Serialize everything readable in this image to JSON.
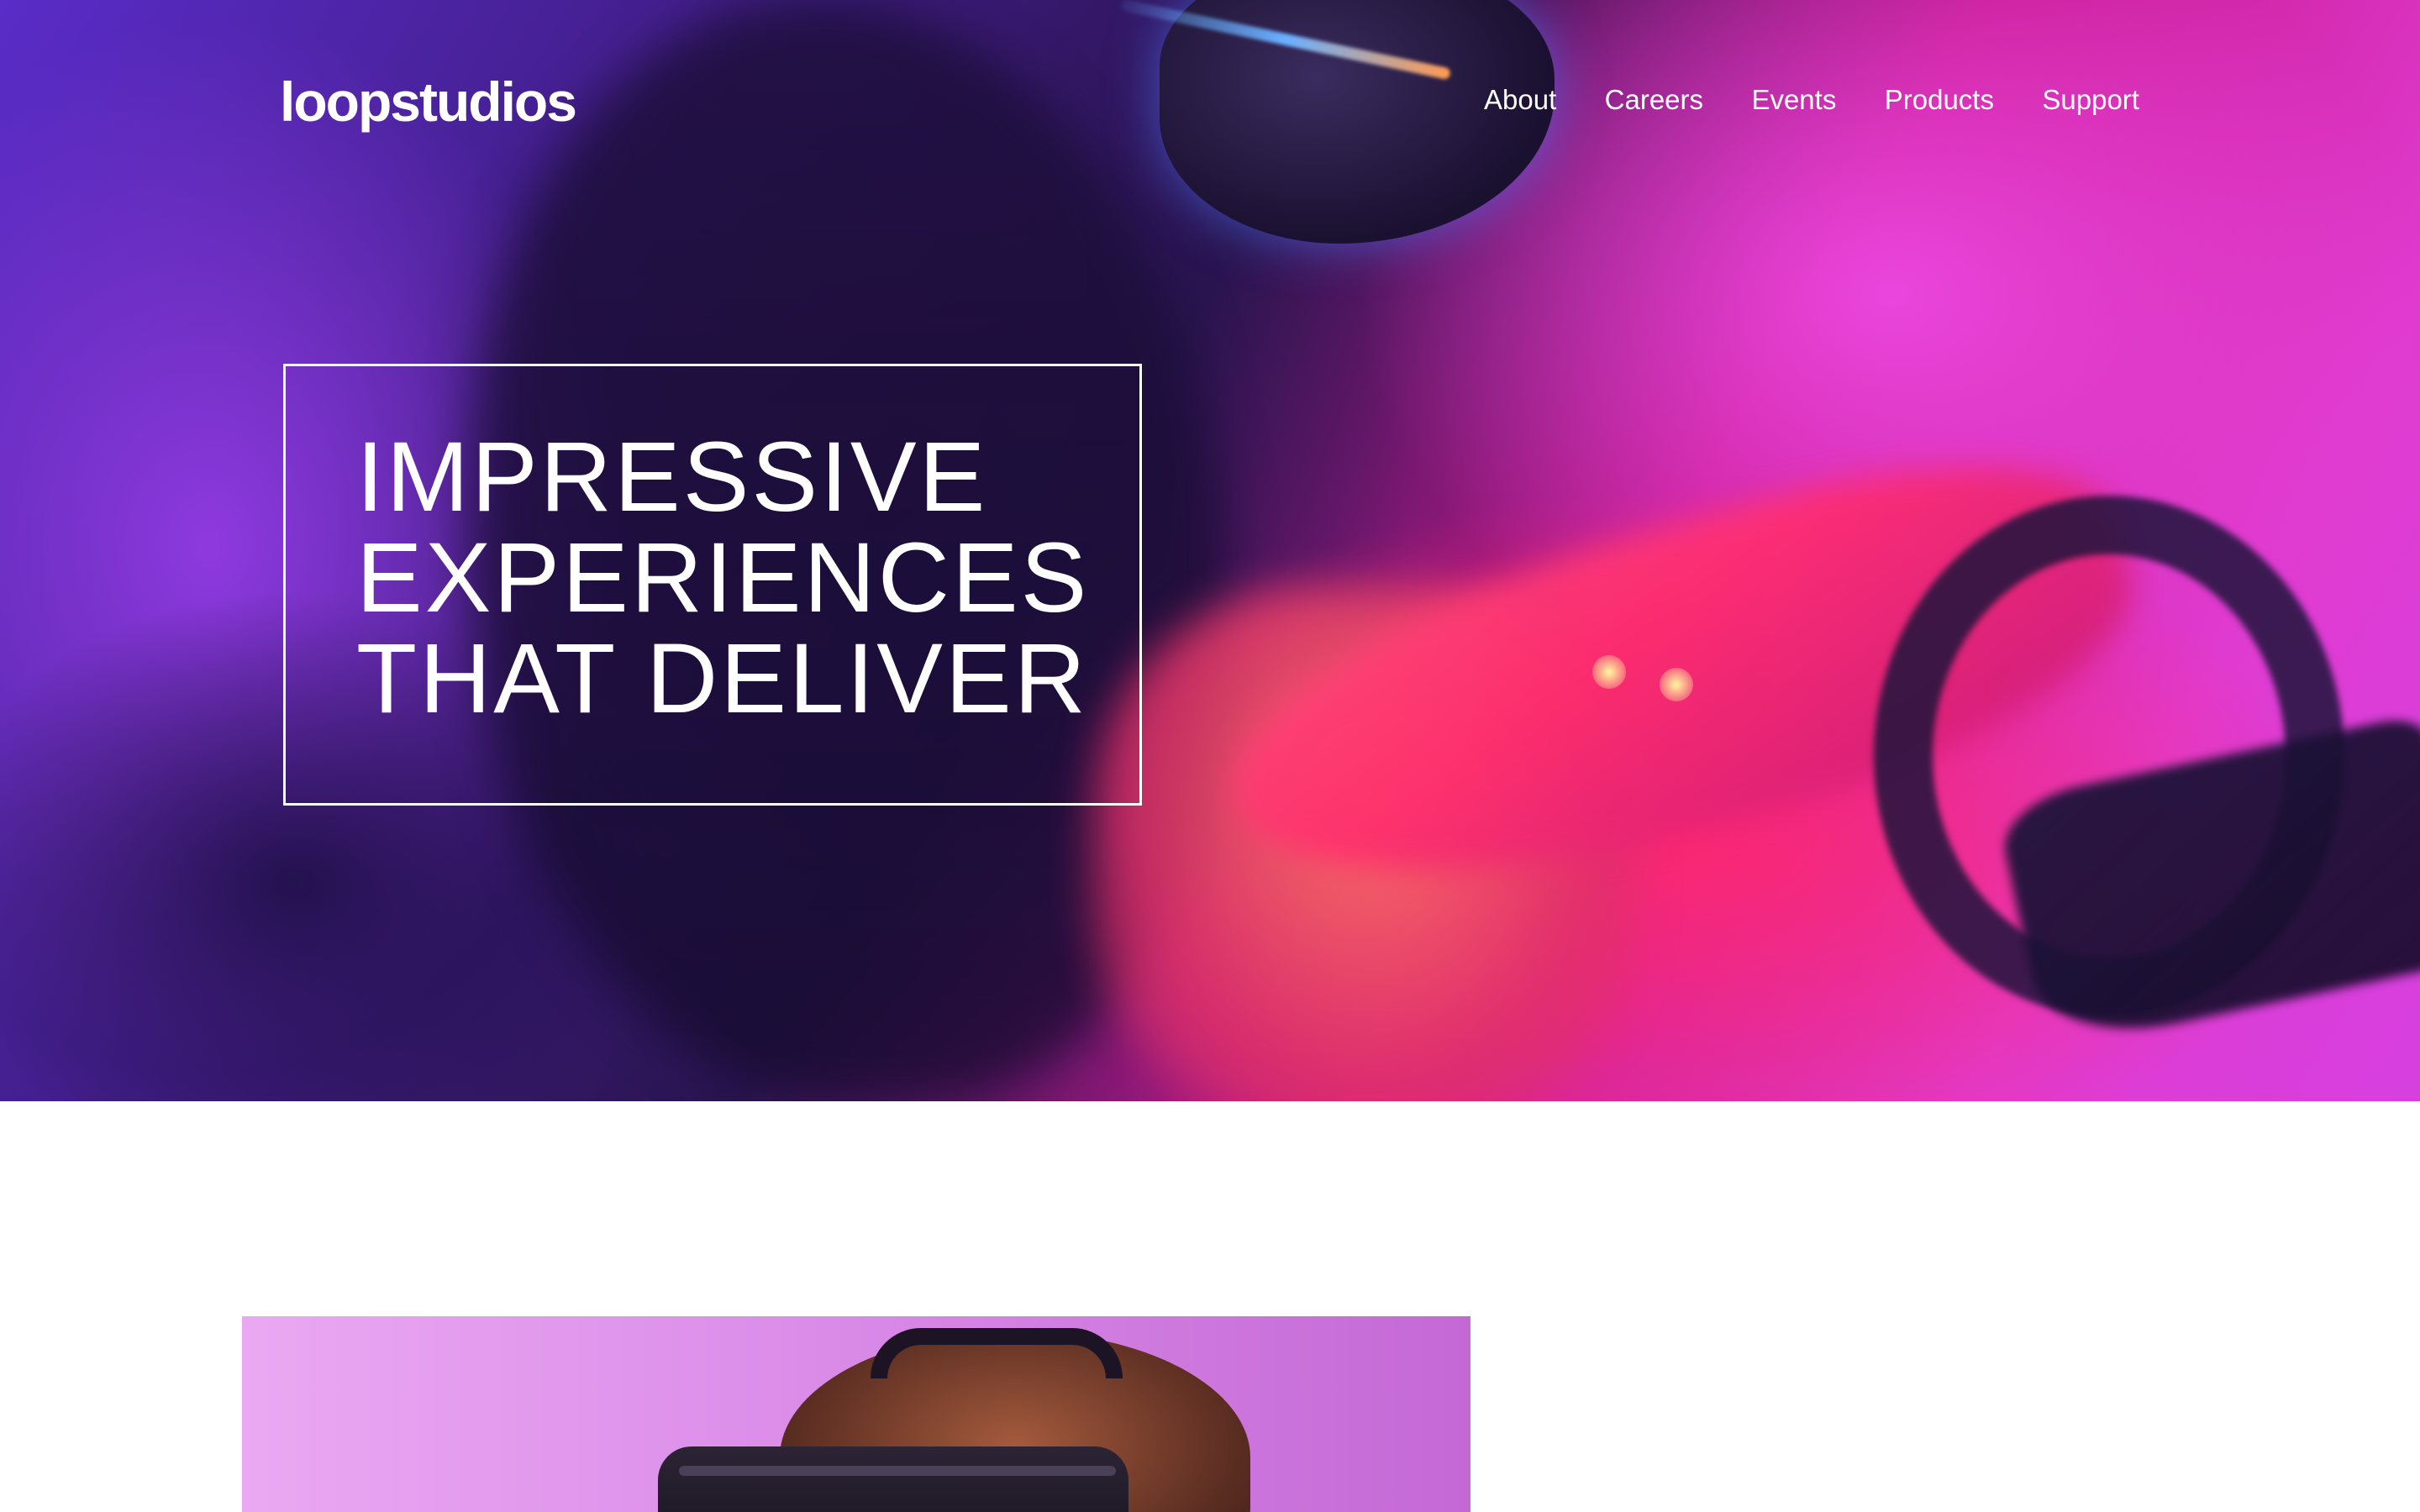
{
  "brand": {
    "logo_text": "loopstudios"
  },
  "nav": {
    "items": [
      {
        "label": "About"
      },
      {
        "label": "Careers"
      },
      {
        "label": "Events"
      },
      {
        "label": "Products"
      },
      {
        "label": "Support"
      }
    ]
  },
  "hero": {
    "headline_lines": [
      "IMPRESSIVE",
      "EXPERIENCES",
      "THAT DELIVER"
    ],
    "image": "woman-in-vr-headset-driving-simulator"
  },
  "feature": {
    "image": "man-wearing-vr-headset"
  },
  "colors": {
    "hero_magenta": "#e03bd0",
    "hero_pink": "#ff2d6e",
    "hero_purple": "#3b1a78",
    "text_light": "#ffffff",
    "feature_bg": "#dd90ea"
  }
}
